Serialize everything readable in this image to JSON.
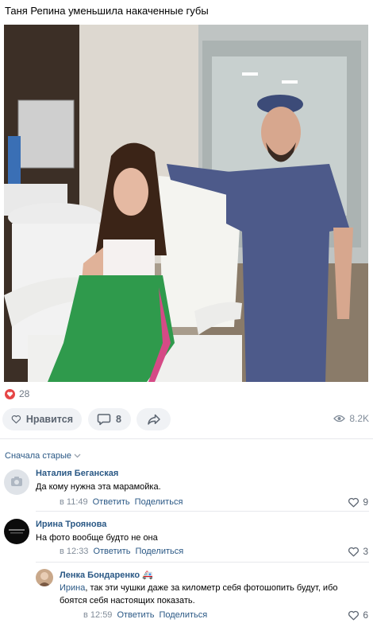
{
  "post": {
    "title": "Таня Репина уменьшила накаченные губы"
  },
  "reactions": {
    "count": "28",
    "icon": "heart-icon",
    "color": "#e64646"
  },
  "actions": {
    "like_label": "Нравится",
    "comments_count": "8",
    "views": "8.2K"
  },
  "sort": {
    "label": "Сначала старые"
  },
  "comments": [
    {
      "author": "Наталия Беганская",
      "text": "Да кому нужна эта марамойка.",
      "time": "в 11:49",
      "reply": "Ответить",
      "share": "Поделиться",
      "likes": "9"
    },
    {
      "author": "Ирина Троянова",
      "text": "На фото вообще будто не она",
      "time": "в 12:33",
      "reply": "Ответить",
      "share": "Поделиться",
      "likes": "3"
    },
    {
      "author": "Ленка Бондаренко 🚑",
      "mention": "Ирина",
      "text": ", так эти чушки даже за километр себя фотошопить будут, ибо боятся себя настоящих показать.",
      "time": "в 12:59",
      "reply": "Ответить",
      "share": "Поделиться",
      "likes": "6"
    }
  ]
}
